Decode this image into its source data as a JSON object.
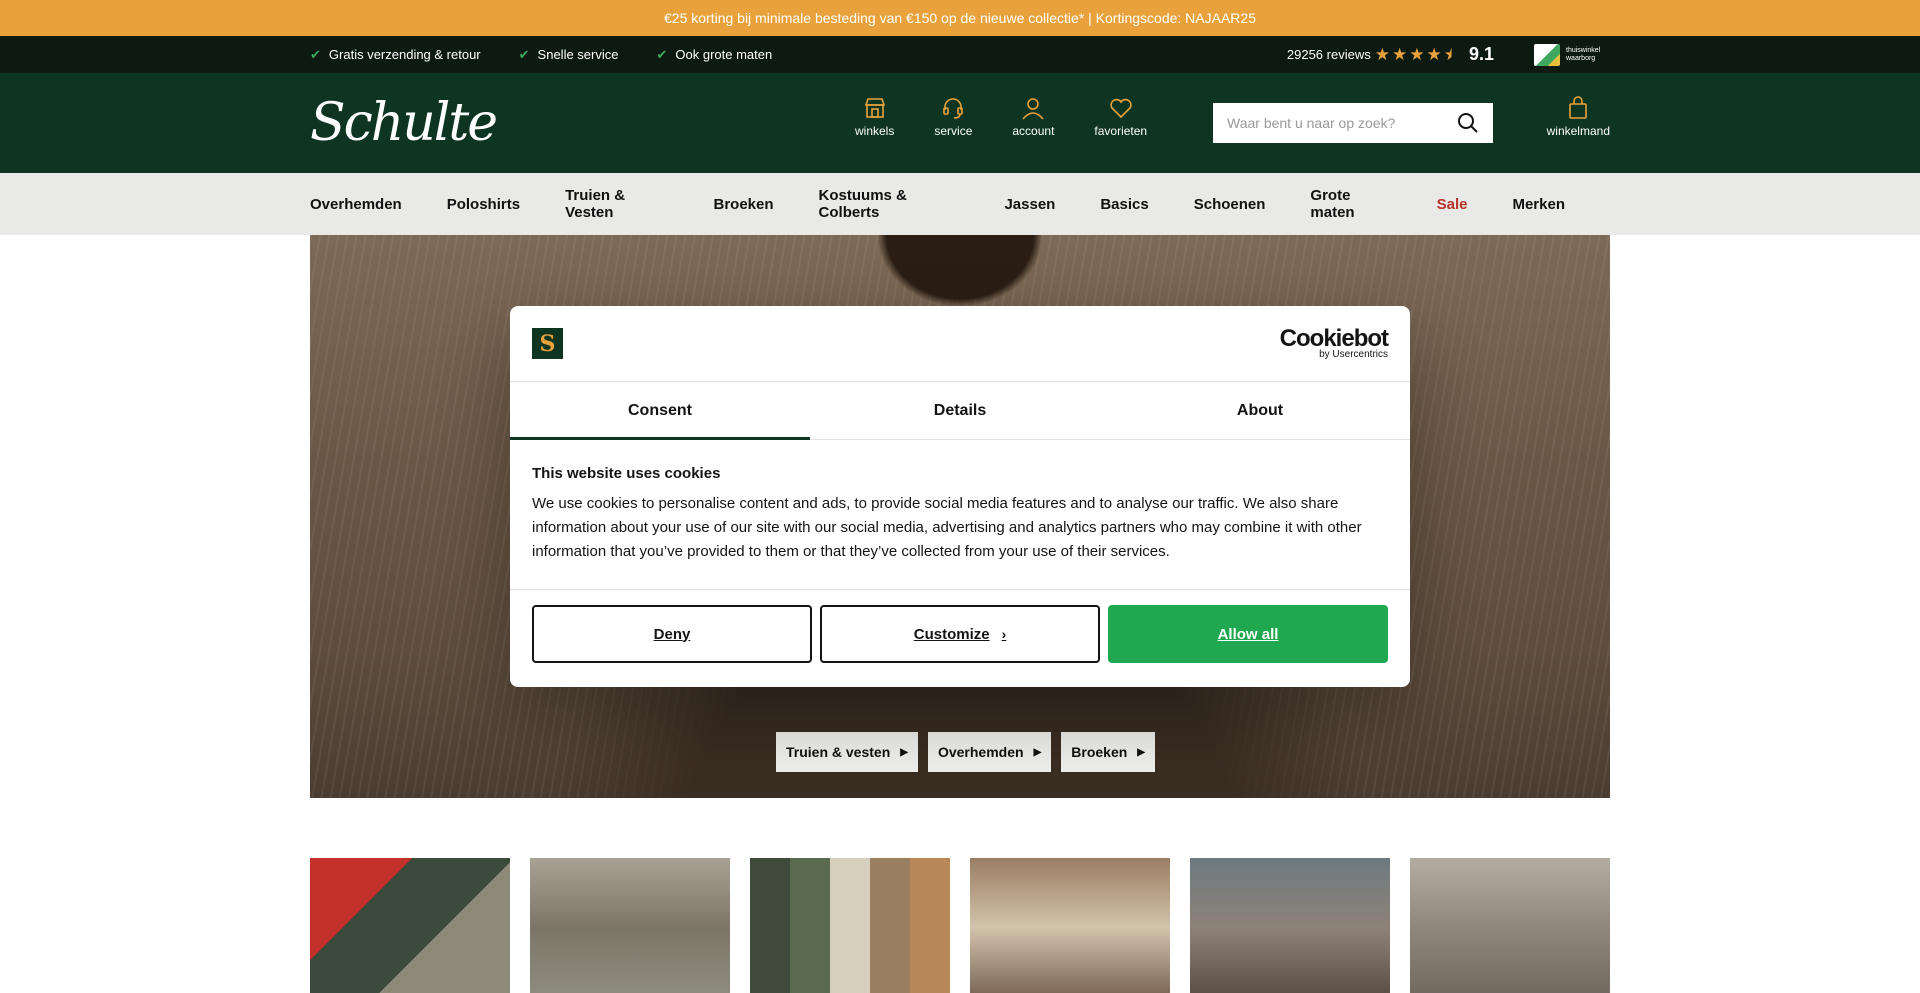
{
  "promo": {
    "text": "€25 korting bij minimale besteding van €150 op de nieuwe collectie* | Kortingscode: NAJAAR25"
  },
  "usp": {
    "items": [
      "Gratis verzending & retour",
      "Snelle service",
      "Ook grote maten"
    ],
    "reviews_count": "29256 reviews",
    "stars": 4.5,
    "rating": "9.1",
    "badge_text": "thuiswinkel waarborg"
  },
  "header": {
    "logo": "Schulte",
    "icon_nav": [
      {
        "label": "winkels",
        "icon": "store-icon"
      },
      {
        "label": "service",
        "icon": "headset-icon"
      },
      {
        "label": "account",
        "icon": "user-icon"
      },
      {
        "label": "favorieten",
        "icon": "heart-icon"
      }
    ],
    "search_placeholder": "Waar bent u naar op zoek?",
    "cart_label": "winkelmand"
  },
  "nav": {
    "items": [
      "Overhemden",
      "Poloshirts",
      "Truien & Vesten",
      "Broeken",
      "Kostuums & Colberts",
      "Jassen",
      "Basics",
      "Schoenen",
      "Grote maten",
      "Sale",
      "Merken"
    ]
  },
  "hero": {
    "buttons": [
      "Truien & vesten",
      "Overhemden",
      "Broeken"
    ]
  },
  "cookie": {
    "logo_letter": "S",
    "brand_name": "Cookiebot",
    "brand_sub": "by Usercentrics",
    "tabs": [
      "Consent",
      "Details",
      "About"
    ],
    "title": "This website uses cookies",
    "text": "We use cookies to personalise content and ads, to provide social media features and to analyse our traffic. We also share information about your use of our site with our social media, advertising and analytics partners who may combine it with other information that you’ve provided to them or that they’ve collected from your use of their services.",
    "deny": "Deny",
    "customize": "Customize",
    "allow": "Allow all"
  },
  "colors": {
    "promo": "#e9a23b",
    "header": "#0e3522",
    "allow": "#1fa84f",
    "sale": "#b8322a"
  }
}
